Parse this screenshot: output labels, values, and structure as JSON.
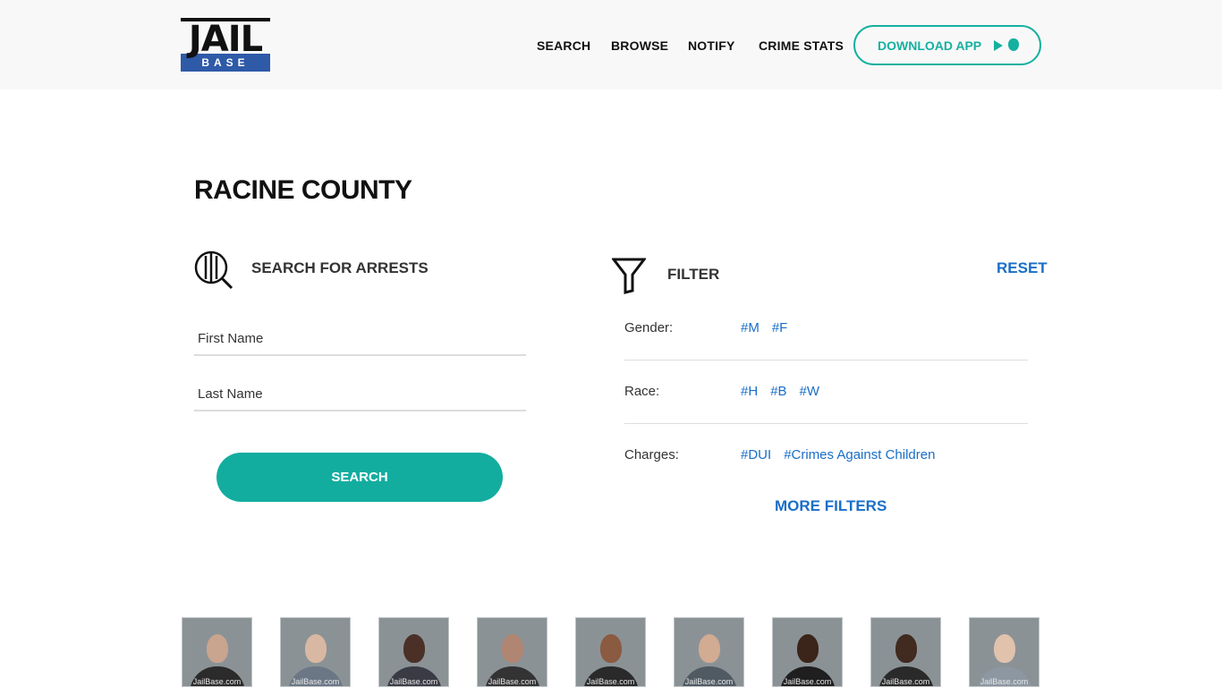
{
  "brand": {
    "logo_top": "JAIL",
    "logo_bottom": "BASE"
  },
  "nav": {
    "search": "SEARCH",
    "browse": "BROWSE",
    "notify": "NOTIFY",
    "crime_stats": "CRIME STATS",
    "download": "DOWNLOAD APP"
  },
  "page": {
    "title": "RACINE COUNTY"
  },
  "search": {
    "heading": "SEARCH FOR ARRESTS",
    "first_name_placeholder": "First Name",
    "last_name_placeholder": "Last Name",
    "button": "SEARCH"
  },
  "filter": {
    "heading": "FILTER",
    "reset": "RESET",
    "rows": [
      {
        "label": "Gender:",
        "tags": [
          "#M",
          "#F"
        ]
      },
      {
        "label": "Race:",
        "tags": [
          "#H",
          "#B",
          "#W"
        ]
      },
      {
        "label": "Charges:",
        "tags": [
          "#DUI",
          "#Crimes Against Children"
        ]
      }
    ],
    "more": "MORE FILTERS"
  },
  "mugshots": {
    "watermark": "JailBase.com",
    "items": [
      {
        "skin": "#c9a48e",
        "shirt": "#2b2b2b"
      },
      {
        "skin": "#d8b8a3",
        "shirt": "#6b7785"
      },
      {
        "skin": "#4a3027",
        "shirt": "#3b3b45"
      },
      {
        "skin": "#b08572",
        "shirt": "#333333"
      },
      {
        "skin": "#8a5a41",
        "shirt": "#2a2a2a"
      },
      {
        "skin": "#d1ab92",
        "shirt": "#505a63"
      },
      {
        "skin": "#3b2419",
        "shirt": "#1f1f1f"
      },
      {
        "skin": "#412a1f",
        "shirt": "#2a2a2a"
      },
      {
        "skin": "#e0c2ad",
        "shirt": "#8c97a1"
      }
    ]
  },
  "colors": {
    "teal": "#13ada0",
    "link_blue": "#1a6ec8",
    "logo_blue": "#2e5aa8"
  }
}
